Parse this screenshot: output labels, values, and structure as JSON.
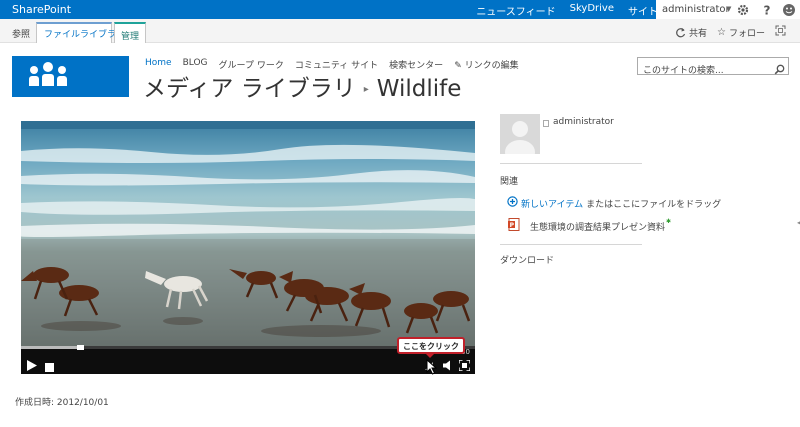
{
  "suite_bar": {
    "brand": "SharePoint",
    "links": [
      "ニュースフィード",
      "SkyDrive",
      "サイト"
    ],
    "user_name": "administrator"
  },
  "ribbon": {
    "tabs": [
      "参照",
      "ファイル",
      "ライブラリ",
      "管理"
    ],
    "share": "共有",
    "follow": "フォロー"
  },
  "top_nav": [
    "Home",
    "BLOG",
    "グループ ワーク",
    "コミュニティ サイト",
    "検索センター"
  ],
  "edit_links": "リンクの編集",
  "breadcrumb": {
    "library": "メディア ライブラリ",
    "item": "Wildlife"
  },
  "search": {
    "placeholder": "このサイトの検索..."
  },
  "video": {
    "tooltip": "ここをクリック",
    "time": "30",
    "progress": 0.13
  },
  "sidebar": {
    "author": "administrator",
    "related_heading": "関連",
    "new_item_link": "新しいアイテム",
    "new_item_rest": "またはここにファイルをドラッグ",
    "document": "生態環境の調査結果プレゼン資料",
    "download_heading": "ダウンロード"
  },
  "created": "作成日時: 2012/10/01",
  "colors": {
    "suite_bar": "#0072c6",
    "link": "#0072c6",
    "callout_border": "#c0202a"
  }
}
